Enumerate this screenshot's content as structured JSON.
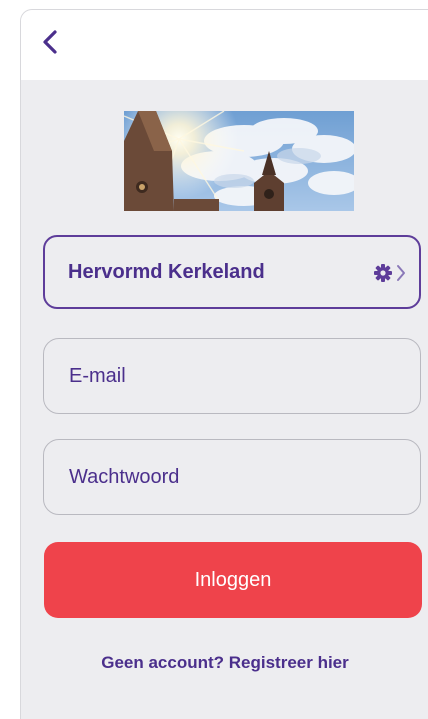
{
  "header": {
    "back_icon": "chevron-left-icon"
  },
  "hero": {
    "image": "church-towers-sky-photo"
  },
  "church_selector": {
    "name": "Hervormd Kerkeland",
    "settings_icon": "gear-icon",
    "arrow_icon": "chevron-right-icon"
  },
  "form": {
    "email_placeholder": "E-mail",
    "password_placeholder": "Wachtwoord",
    "login_label": "Inloggen",
    "register_link": "Geen account? Registreer hier"
  },
  "colors": {
    "accent": "#4b2f8c",
    "login_button": "#ef434b",
    "background": "#ededf0"
  }
}
